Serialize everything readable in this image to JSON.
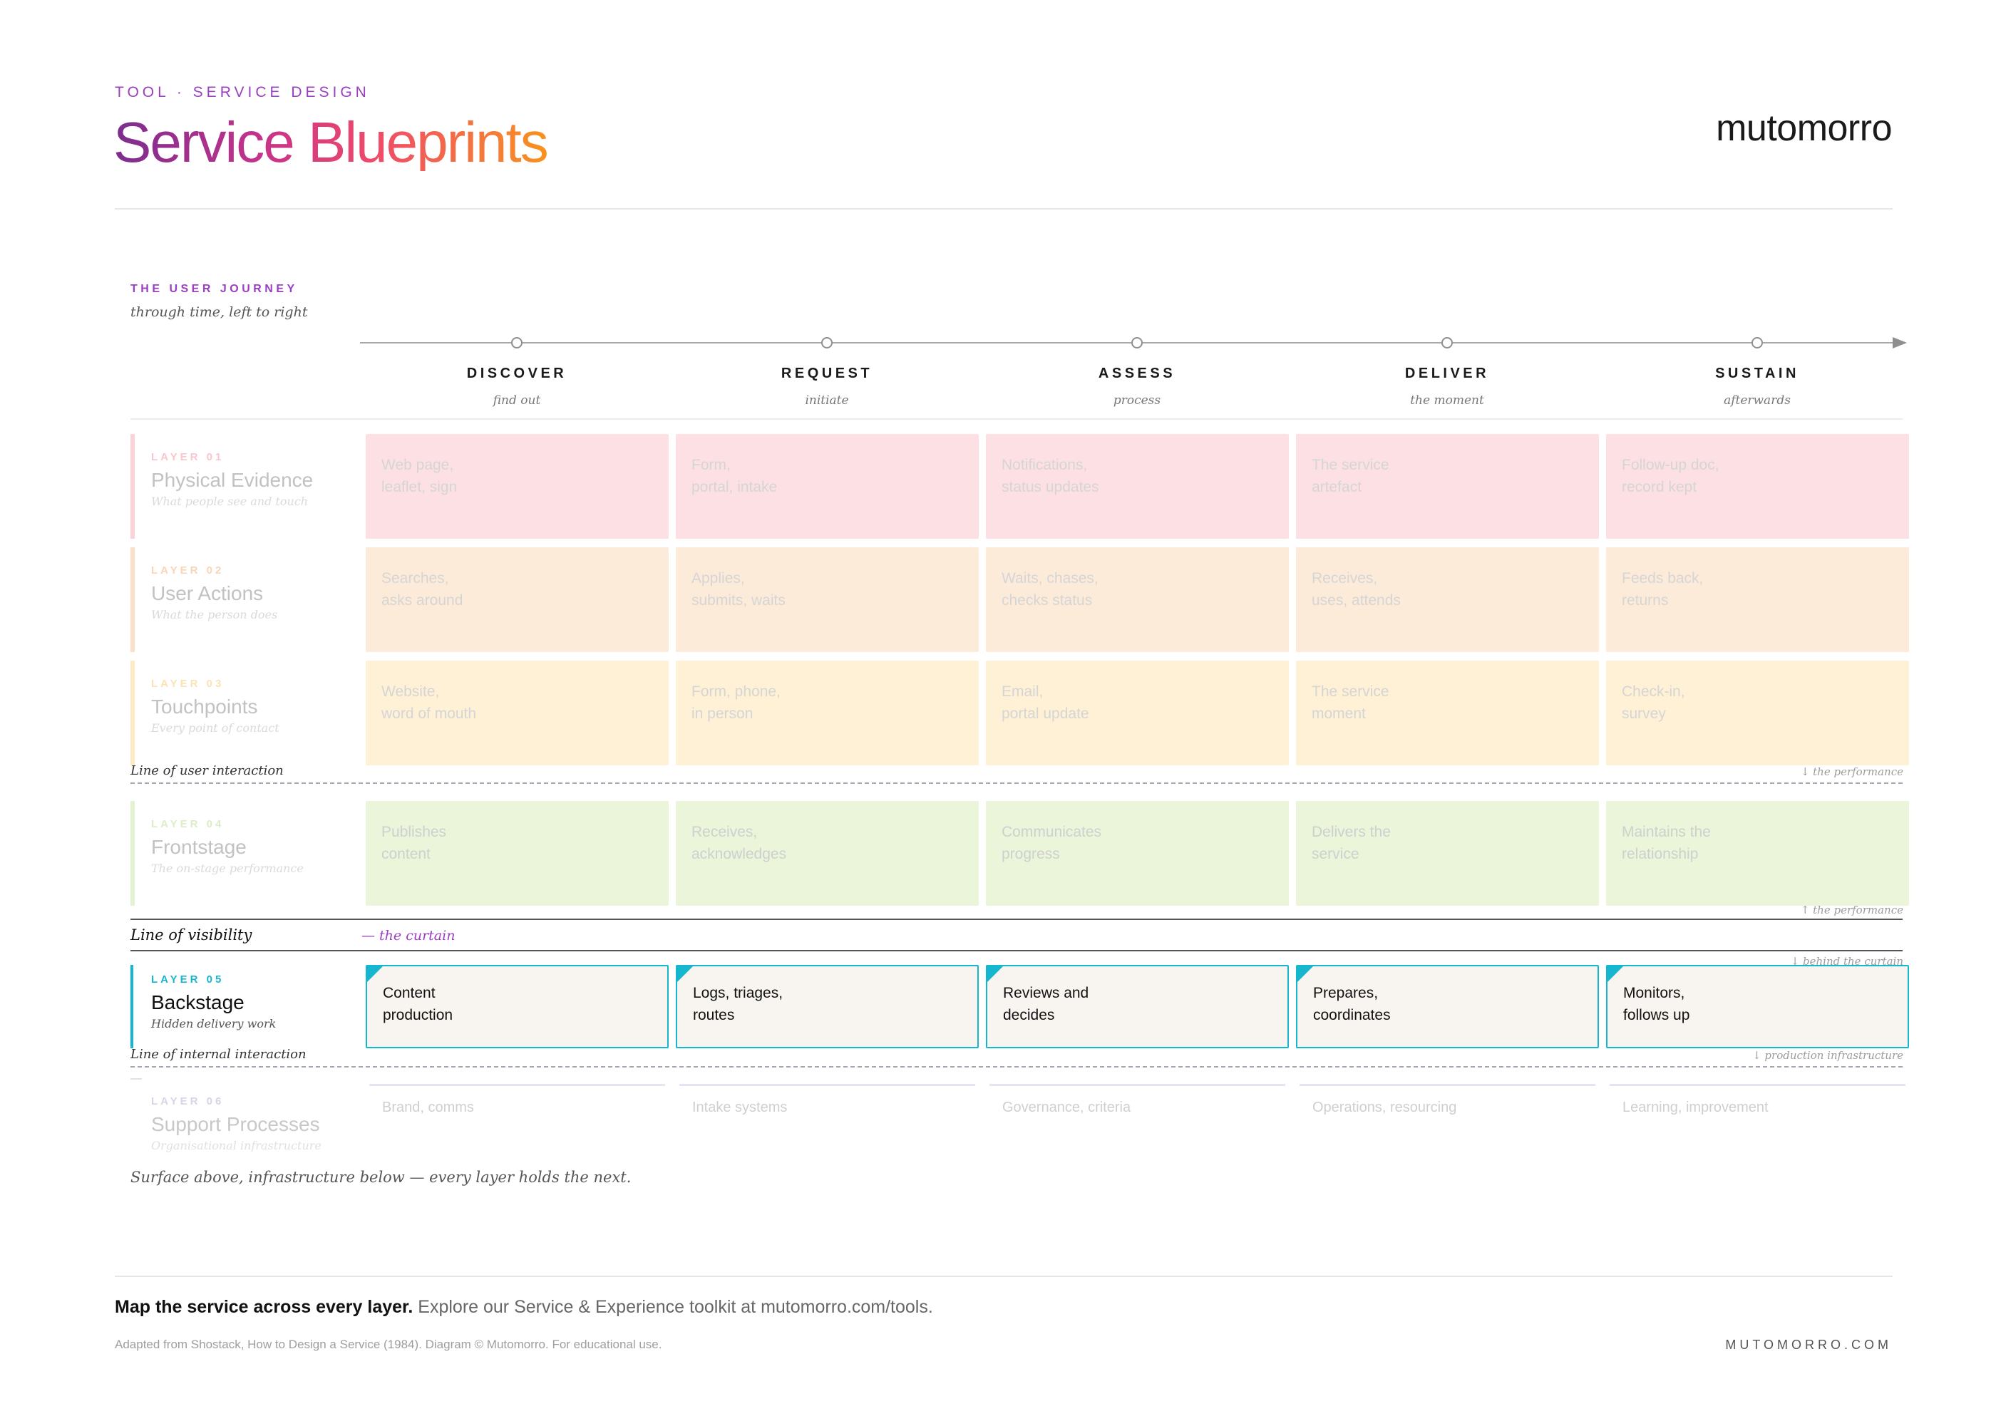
{
  "header": {
    "eyebrow": "TOOL · SERVICE DESIGN",
    "title": "Service Blueprints",
    "brand": "mutomorro"
  },
  "journey": {
    "heading": "THE USER JOURNEY",
    "subheading": "through time, left to right"
  },
  "stages": [
    {
      "name": "DISCOVER",
      "sub": "find out"
    },
    {
      "name": "REQUEST",
      "sub": "initiate"
    },
    {
      "name": "ASSESS",
      "sub": "process"
    },
    {
      "name": "DELIVER",
      "sub": "the moment"
    },
    {
      "name": "SUSTAIN",
      "sub": "afterwards"
    }
  ],
  "layers": {
    "evidence": {
      "num": "LAYER 01",
      "name": "Physical Evidence",
      "desc": "What people see and touch",
      "cells": [
        [
          "Web page,",
          "leaflet, sign"
        ],
        [
          "Form,",
          "portal, intake"
        ],
        [
          "Notifications,",
          "status updates"
        ],
        [
          "The service",
          "artefact"
        ],
        [
          "Follow-up doc,",
          "record kept"
        ]
      ]
    },
    "user_actions": {
      "num": "LAYER 02",
      "name": "User Actions",
      "desc": "What the person does",
      "cells": [
        [
          "Searches,",
          "asks around"
        ],
        [
          "Applies,",
          "submits, waits"
        ],
        [
          "Waits, chases,",
          "checks status"
        ],
        [
          "Receives,",
          "uses, attends"
        ],
        [
          "Feeds back,",
          "returns"
        ]
      ]
    },
    "touchpoints": {
      "num": "LAYER 03",
      "name": "Touchpoints",
      "desc": "Every point of contact",
      "cells": [
        [
          "Website,",
          "word of mouth"
        ],
        [
          "Form, phone,",
          "in person"
        ],
        [
          "Email,",
          "portal update"
        ],
        [
          "The service",
          "moment"
        ],
        [
          "Check-in,",
          "survey"
        ]
      ]
    },
    "frontstage": {
      "num": "LAYER 04",
      "name": "Frontstage",
      "desc": "The on-stage performance",
      "cells": [
        [
          "Publishes",
          "content"
        ],
        [
          "Receives,",
          "acknowledges"
        ],
        [
          "Communicates",
          "progress"
        ],
        [
          "Delivers the",
          "service"
        ],
        [
          "Maintains the",
          "relationship"
        ]
      ]
    },
    "backstage": {
      "num": "LAYER 05",
      "name": "Backstage",
      "desc": "Hidden delivery work",
      "cells": [
        [
          "Content",
          "production"
        ],
        [
          "Logs, triages,",
          "routes"
        ],
        [
          "Reviews and",
          "decides"
        ],
        [
          "Prepares,",
          "coordinates"
        ],
        [
          "Monitors,",
          "follows up"
        ]
      ]
    },
    "support": {
      "num": "LAYER 06",
      "name": "Support Processes",
      "desc": "Organisational infrastructure",
      "cells": [
        "Brand, comms",
        "Intake systems",
        "Governance, criteria",
        "Operations, resourcing",
        "Learning, improvement"
      ]
    }
  },
  "lines": {
    "interaction": {
      "label": "Line of user interaction",
      "note": "↓ the performance"
    },
    "visibility": {
      "label": "Line of visibility",
      "curtain": "— the curtain",
      "note_above": "↑ the performance",
      "note_below": "↓ behind the curtain"
    },
    "internal": {
      "label": "Line of internal interaction",
      "note": "↓ production infrastructure",
      "dash": "—"
    }
  },
  "summary": "Surface above, infrastructure below — every layer holds the next.",
  "footer": {
    "cta_bold": "Map the service across every layer.",
    "cta_rest": " Explore our Service & Experience toolkit at mutomorro.com/tools.",
    "credit": "Adapted from Shostack, How to Design a Service (1984). Diagram © Mutomorro. For educational use.",
    "site": "MUTOMORRO.COM"
  },
  "colors": {
    "evidence": "#fde0e3",
    "user_actions": "#fdebd9",
    "touchpoints": "#fef1d6",
    "frontstage": "#eaf5d9",
    "backstage_accent": "#17b6cf",
    "journey_accent": "#9a3fc2"
  }
}
